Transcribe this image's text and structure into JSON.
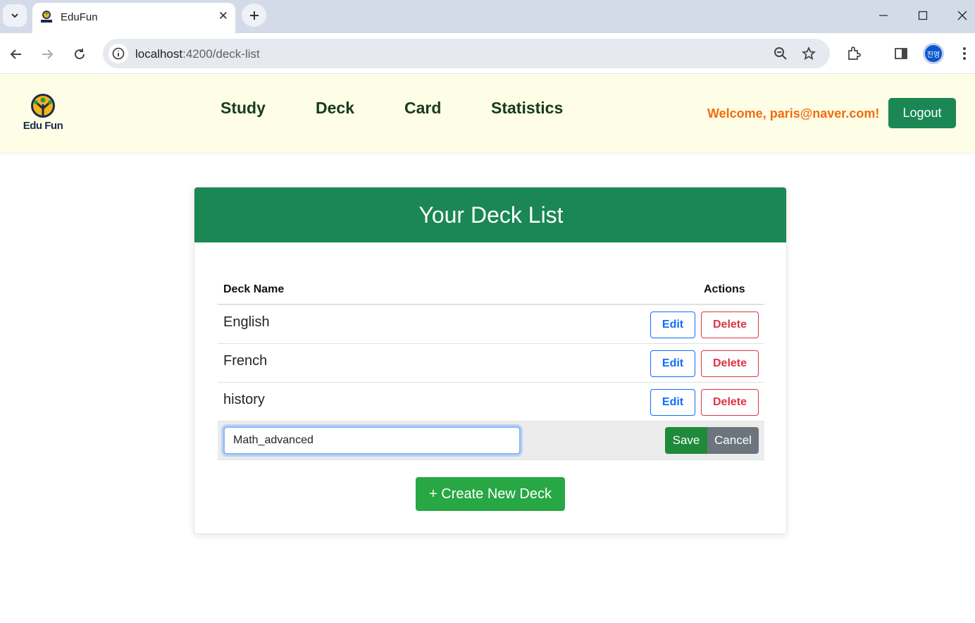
{
  "browser": {
    "tab_title": "EduFun",
    "url_host": "localhost",
    "url_path": ":4200/deck-list",
    "profile_initials": "진영"
  },
  "header": {
    "logo_text": "Edu Fun",
    "nav": [
      {
        "label": "Study"
      },
      {
        "label": "Deck"
      },
      {
        "label": "Card"
      },
      {
        "label": "Statistics"
      }
    ],
    "welcome": "Welcome,  paris@naver.com!",
    "logout_label": "Logout"
  },
  "deck_list": {
    "title": "Your Deck List",
    "columns": [
      "Deck Name",
      "Actions"
    ],
    "rows": [
      {
        "name": "English",
        "edit_label": "Edit",
        "delete_label": "Delete"
      },
      {
        "name": "French",
        "edit_label": "Edit",
        "delete_label": "Delete"
      },
      {
        "name": "history",
        "edit_label": "Edit",
        "delete_label": "Delete"
      }
    ],
    "editing_row": {
      "value": "Math_advanced",
      "save_label": "Save",
      "cancel_label": "Cancel"
    },
    "create_label": "+ Create New Deck"
  },
  "colors": {
    "primary_green": "#1a8754",
    "header_bg": "#fefee6",
    "welcome_orange": "#f26b0f",
    "edit_blue": "#0d6efd",
    "delete_red": "#dc3545"
  }
}
